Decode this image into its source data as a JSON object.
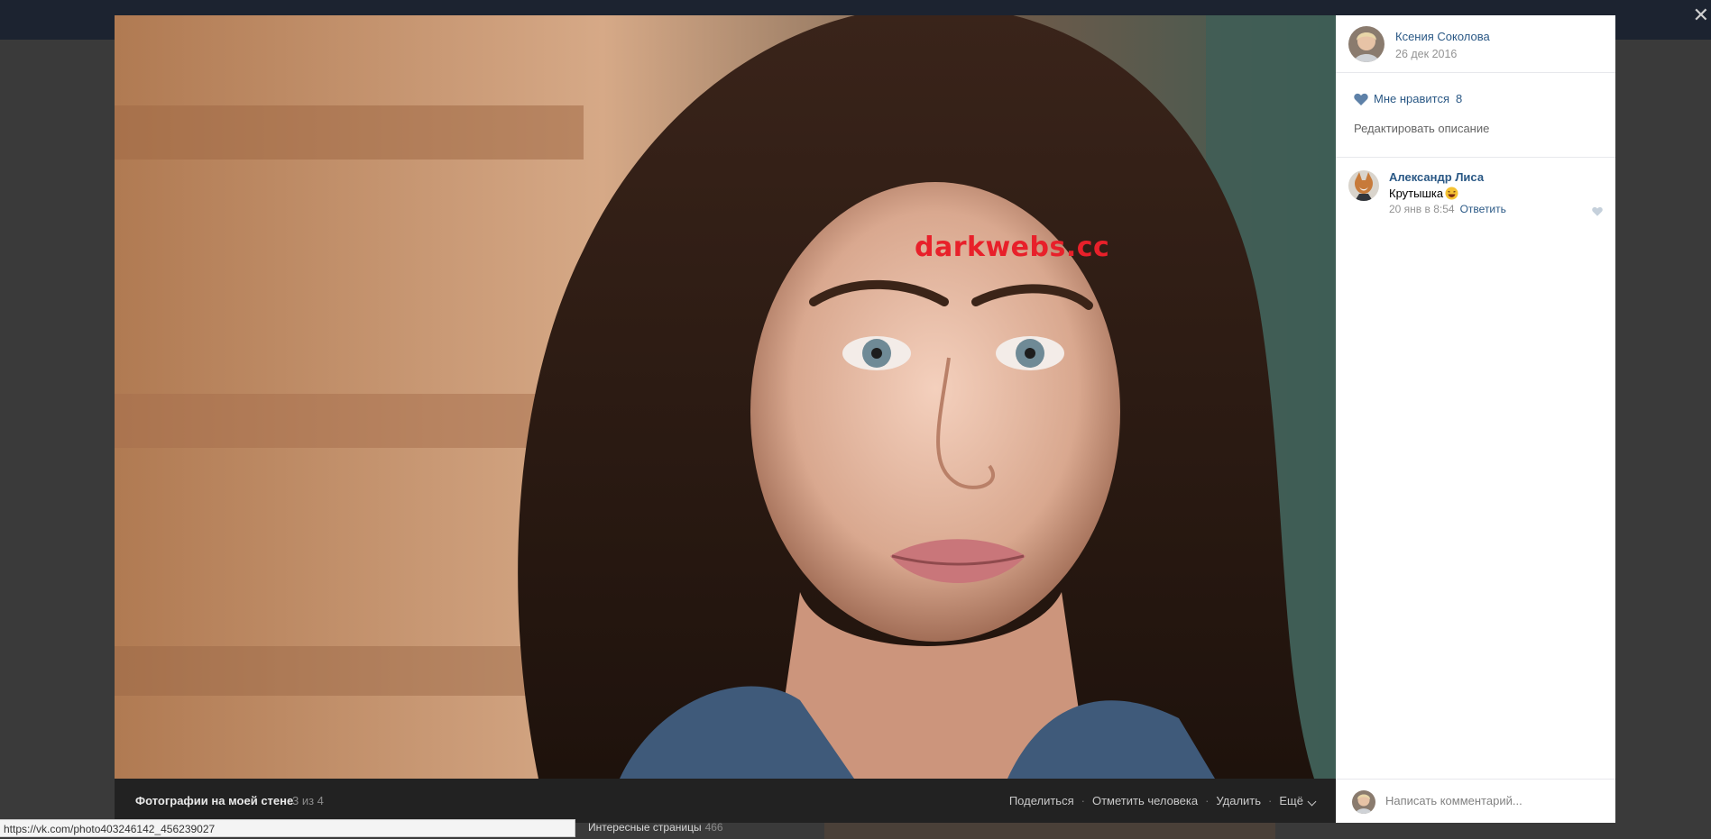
{
  "viewer": {
    "album_title": "Фотографии на моей стене",
    "counter": "3 из 4",
    "actions": {
      "share": "Поделиться",
      "tag": "Отметить человека",
      "delete": "Удалить",
      "more": "Ещё"
    },
    "watermark": "darkwebs.cc"
  },
  "sidebar": {
    "author_name": "Ксения Соколова",
    "author_date": "26 дек 2016",
    "like_label": "Мне нравится",
    "like_count": "8",
    "edit_description": "Редактировать описание",
    "comments": [
      {
        "name": "Александр Лиса",
        "text": "Крутышка",
        "date": "20 янв в 8:54",
        "reply": "Ответить"
      }
    ],
    "composer_placeholder": "Написать комментарий..."
  },
  "status_bar": {
    "url": "https://vk.com/photo403246142_456239027"
  },
  "background_page": {
    "section": "Интересные страницы",
    "count": "466"
  },
  "colors": {
    "link": "#2a5885",
    "watermark": "#e8202a",
    "bottombar": "#222222"
  }
}
